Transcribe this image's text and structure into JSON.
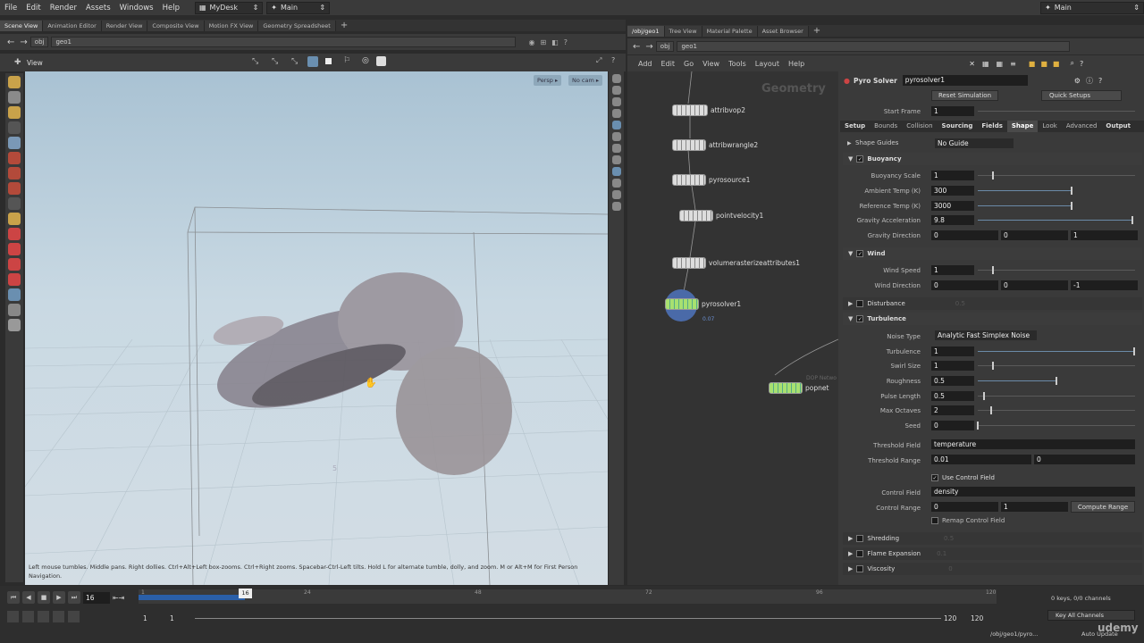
{
  "menu": {
    "items": [
      "File",
      "Edit",
      "Render",
      "Assets",
      "Windows",
      "Help"
    ],
    "desktop": "MyDesk",
    "main": "Main",
    "right_main": "Main"
  },
  "left_tabs": [
    "Scene View",
    "Animation Editor",
    "Render View",
    "Composite View",
    "Motion FX View",
    "Geometry Spreadsheet"
  ],
  "right_tabs": [
    "/obj/geo1",
    "Tree View",
    "Material Palette",
    "Asset Browser"
  ],
  "path": {
    "obj": "obj",
    "geo": "geo1"
  },
  "viewport": {
    "title": "View",
    "persp": "Persp",
    "cam": "No cam",
    "hint": "Left mouse tumbles. Middle pans. Right dollies. Ctrl+Alt+Left box-zooms. Ctrl+Right zooms. Spacebar-Ctrl-Left tilts. Hold L for alternate tumble, dolly, and zoom.    M or Alt+M for First Person Navigation.",
    "grid_label": "5"
  },
  "network": {
    "menu": [
      "Add",
      "Edit",
      "Go",
      "View",
      "Tools",
      "Layout",
      "Help"
    ],
    "watermark": "Geometry",
    "nodes": [
      "attribvop2",
      "attribwrangle2",
      "pyrosource1",
      "pointvelocity1",
      "volumerasterizeattributes1",
      "pyrosolver1",
      "popnet"
    ],
    "pyro_time": "0.07",
    "dop_label": "DOP Netwo"
  },
  "params": {
    "type": "Pyro Solver",
    "name": "pyrosolver1",
    "reset": "Reset Simulation",
    "quick": "Quick Setups",
    "start_frame_label": "Start Frame",
    "start_frame": "1",
    "tabs": [
      "Setup",
      "Bounds",
      "Collision",
      "Sourcing",
      "Fields",
      "Shape",
      "Look",
      "Advanced",
      "Output"
    ],
    "shape_guides_label": "Shape Guides",
    "shape_guides": "No Guide",
    "buoyancy": "Buoyancy",
    "b_rows": [
      [
        "Buoyancy Scale",
        "1"
      ],
      [
        "Ambient Temp (K)",
        "300"
      ],
      [
        "Reference Temp (K)",
        "3000"
      ],
      [
        "Gravity Acceleration",
        "9.8"
      ]
    ],
    "grav_dir_label": "Gravity Direction",
    "grav_dir": [
      "0",
      "0",
      "1"
    ],
    "wind": "Wind",
    "wind_speed_label": "Wind Speed",
    "wind_speed": "1",
    "wind_dir_label": "Wind Direction",
    "wind_dir": [
      "0",
      "0",
      "-1"
    ],
    "disturbance": "Disturbance",
    "disturbance_val": "0.5",
    "turbulence": "Turbulence",
    "noise_type_label": "Noise Type",
    "noise_type": "Analytic Fast Simplex Noise",
    "t_rows": [
      [
        "Turbulence",
        "1"
      ],
      [
        "Swirl Size",
        "1"
      ],
      [
        "Roughness",
        "0.5"
      ],
      [
        "Pulse Length",
        "0.5"
      ],
      [
        "Max Octaves",
        "2"
      ],
      [
        "Seed",
        "0"
      ]
    ],
    "threshold_field_label": "Threshold Field",
    "threshold_field": "temperature",
    "threshold_range_label": "Threshold Range",
    "threshold_range": [
      "0.01",
      "0"
    ],
    "use_control": "Use Control Field",
    "control_field_label": "Control Field",
    "control_field": "density",
    "control_range_label": "Control Range",
    "control_range": [
      "0",
      "1"
    ],
    "compute_range": "Compute Range",
    "remap": "Remap Control Field",
    "shredding": "Shredding",
    "shred_val": "0.5",
    "flame": "Flame Expansion",
    "flame_val": "0.1",
    "viscosity": "Viscosity",
    "visc_val": "0"
  },
  "timeline": {
    "frame": "16",
    "marker": "16",
    "ticks": [
      "1",
      "24",
      "48",
      "72",
      "96",
      "120"
    ],
    "start": "1",
    "start2": "1",
    "end": "120",
    "end2": "120",
    "keys": "0 keys, 0/0 channels",
    "key_all": "Key All Channels",
    "status_path": "/obj/geo1/pyro...",
    "auto_update": "Auto Update",
    "watermark": "udemy"
  }
}
